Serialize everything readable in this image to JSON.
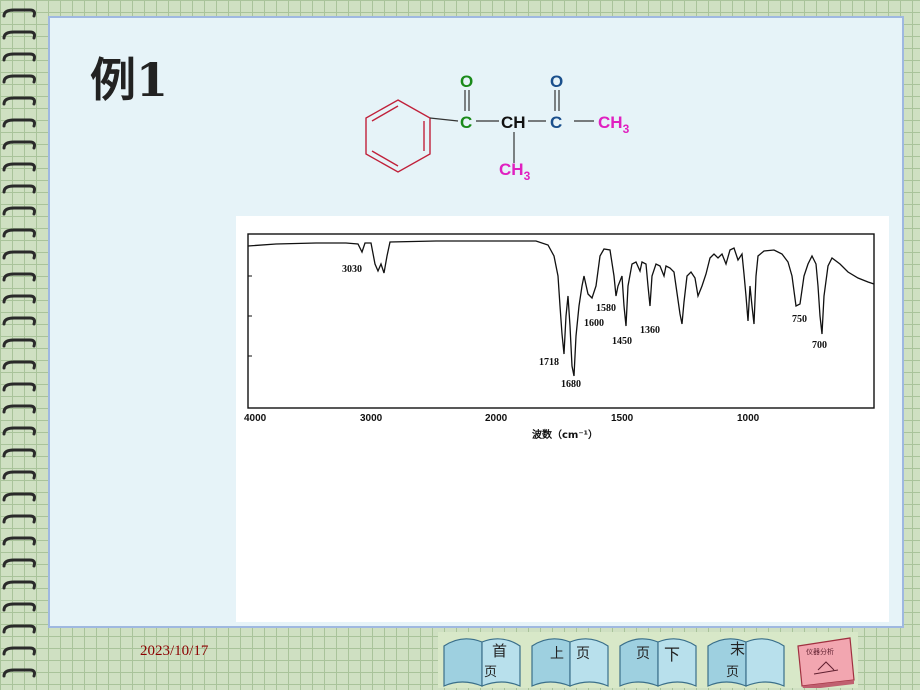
{
  "slide": {
    "title": "例1",
    "date": "2023/10/17"
  },
  "molecule": {
    "carbonyl1": {
      "o": "O",
      "c": "C"
    },
    "center": "CH",
    "carbonyl2": {
      "o": "O",
      "c": "C"
    },
    "methyl_right": {
      "base": "CH",
      "sub": "3"
    },
    "methyl_down": {
      "base": "CH",
      "sub": "3"
    },
    "colors": {
      "green": "#1a8a1a",
      "blue": "#1a4f8c",
      "magenta": "#e020c0",
      "ring": "#c0203a"
    }
  },
  "spectrum": {
    "x_axis_label": "波数（cm⁻¹）",
    "x_ticks": [
      "4000",
      "3000",
      "2000",
      "1500",
      "1000"
    ],
    "peak_labels": [
      "3030",
      "1718",
      "1680",
      "1600",
      "1580",
      "1450",
      "1360",
      "750",
      "700"
    ]
  },
  "nav": {
    "first": {
      "top": "首",
      "bottom": "页"
    },
    "prev": {
      "top": "上",
      "bottom": "页"
    },
    "next": {
      "top": "页",
      "bottom": "下"
    },
    "last": {
      "top": "末",
      "bottom": "页"
    },
    "book_label": "仪器分析"
  }
}
